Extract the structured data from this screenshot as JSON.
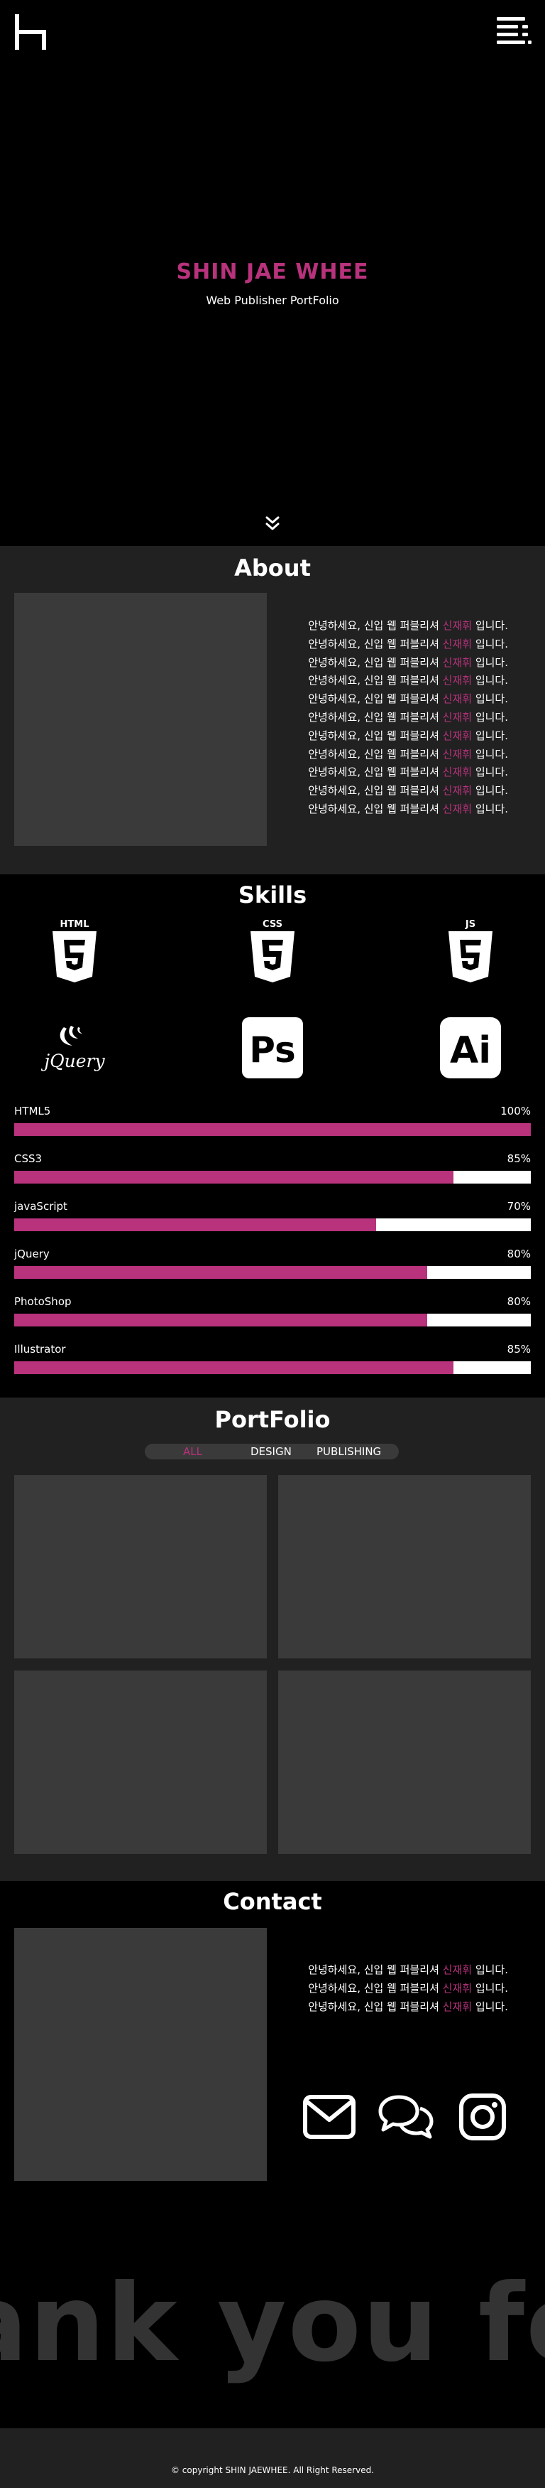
{
  "hero": {
    "title": "SHIN JAE WHEE",
    "subtitle": "Web Publisher PortFolio"
  },
  "about": {
    "title": "About",
    "line_prefix": "안녕하세요, 신입 웹 퍼블리셔 ",
    "line_name": "신재휘",
    "line_suffix": " 입니다.",
    "line_count": 11
  },
  "skills": {
    "title": "Skills",
    "icons": [
      "html5-icon",
      "css3-icon",
      "js-icon",
      "jquery-logo",
      "photoshop-icon",
      "illustrator-icon"
    ],
    "icon_text": {
      "html": "HTML",
      "css": "CSS",
      "js": "JS",
      "jquery": "jQuery",
      "ps": "Ps",
      "ai": "Ai"
    },
    "bars": [
      {
        "label": "HTML5",
        "percent_text": "100%",
        "value": 100
      },
      {
        "label": "CSS3",
        "percent_text": "85%",
        "value": 85
      },
      {
        "label": "javaScript",
        "percent_text": "70%",
        "value": 70
      },
      {
        "label": "jQuery",
        "percent_text": "80%",
        "value": 80
      },
      {
        "label": "PhotoShop",
        "percent_text": "80%",
        "value": 80
      },
      {
        "label": "Illustrator",
        "percent_text": "85%",
        "value": 85
      }
    ]
  },
  "portfolio": {
    "title": "PortFolio",
    "filters": [
      "ALL",
      "DESIGN",
      "PUBLISHING"
    ],
    "active_filter": "ALL"
  },
  "contact": {
    "title": "Contact",
    "line_prefix": "안녕하세요, 신입 웹 퍼블리셔 ",
    "line_name": "신재휘",
    "line_suffix": " 입니다.",
    "line_count": 3,
    "icons": [
      "mail-icon",
      "chat-icon",
      "instagram-icon"
    ]
  },
  "thanks": {
    "text": "ank you for l"
  },
  "footer": {
    "copyright": "© copyright SHIN JAEWHEE. All Right Reserved."
  },
  "colors": {
    "accent": "#b8327c",
    "panel": "#212121",
    "placeholder": "#3a3a3a"
  }
}
